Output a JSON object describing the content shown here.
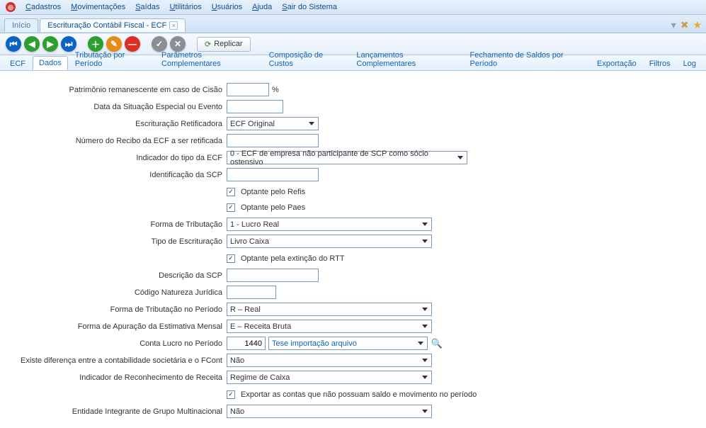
{
  "menu": {
    "items": [
      {
        "key": "C",
        "rest": "adastros"
      },
      {
        "key": "M",
        "rest": "ovimentações"
      },
      {
        "key": "S",
        "rest": "aídas"
      },
      {
        "key": "U",
        "rest": "tilitários"
      },
      {
        "key": "U",
        "rest": "suários"
      },
      {
        "key": "A",
        "rest": "juda"
      },
      {
        "key": "S",
        "rest": "air do Sistema"
      }
    ]
  },
  "doc_tabs": {
    "tab1": "Início",
    "tab2": "Escrituração Contábil Fiscal - ECF"
  },
  "toolbar": {
    "replicar": "Replicar"
  },
  "subtabs": {
    "t0": "ECF",
    "t1": "Dados",
    "t2": "Tributação por Período",
    "t3": "Parâmetros Complementares",
    "t4": "Composição de Custos",
    "t5": "Lançamentos Complementares",
    "t6": "Fechamento de Saldos por Período",
    "t7": "Exportação",
    "t8": "Filtros",
    "t9": "Log"
  },
  "labels": {
    "patrimonio": "Patrimônio remanescente em caso de Cisão",
    "percent": "%",
    "data_sit": "Data da Situação Especial ou Evento",
    "escrit_retif": "Escrituração Retificadora",
    "num_recibo": "Número do Recibo da ECF a ser retificada",
    "indicador_tipo": "Indicador do tipo da ECF",
    "ident_scp": "Identificação da SCP",
    "opt_refis": "Optante pelo Refis",
    "opt_paes": "Optante pelo Paes",
    "forma_trib": "Forma de Tributação",
    "tipo_escrit": "Tipo de Escrituração",
    "opt_rtt": "Optante pela extinção do RTT",
    "desc_scp": "Descrição da SCP",
    "cod_nat": "Código Natureza Jurídica",
    "forma_trib_per": "Forma de Tributação no Período",
    "forma_apur": "Forma de Apuração da Estimativa Mensal",
    "conta_lucro": "Conta Lucro no Período",
    "diff_fcont": "Existe diferença entre a contabilidade societária e o FCont",
    "ind_reconh": "Indicador de Reconhecimento de Receita",
    "exportar_contas": "Exportar as contas que não possuam saldo e movimento no período",
    "entidade_grupo": "Entidade Integrante de Grupo Multinacional"
  },
  "values": {
    "escrit_retif": "ECF Original",
    "indicador_tipo": "0 - ECF de empresa não participante de SCP como sócio ostensivo",
    "forma_trib": "1 - Lucro Real",
    "tipo_escrit": "Livro Caixa",
    "forma_trib_per": "R – Real",
    "forma_apur": "E – Receita Bruta",
    "conta_lucro_code": "1440",
    "conta_lucro_desc": "Tese importação arquivo",
    "diff_fcont": "Não",
    "ind_reconh": "Regime de Caixa",
    "entidade_grupo": "Não"
  },
  "colors": {
    "blue": "#1163b0",
    "green": "#2e9e2e",
    "orange": "#e78b16",
    "red": "#d93025",
    "gray": "#8a8f96"
  }
}
